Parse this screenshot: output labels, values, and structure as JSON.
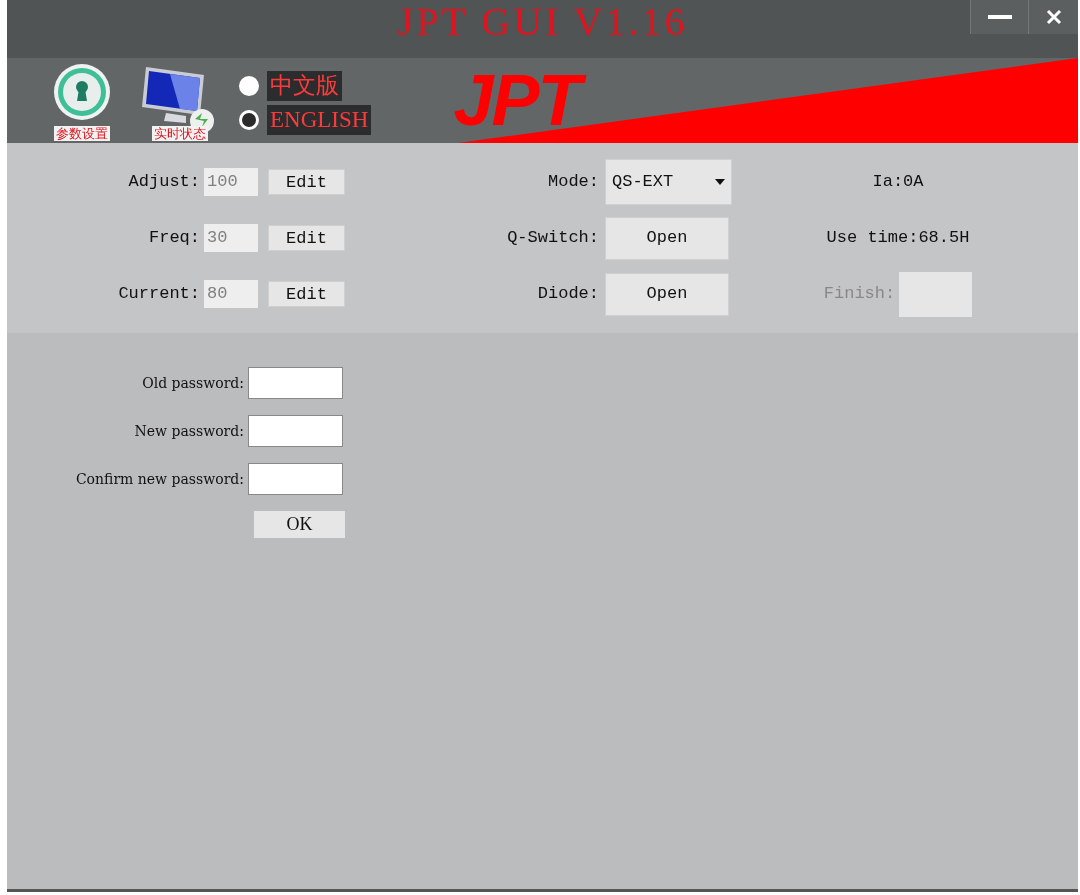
{
  "window": {
    "title": "JPT GUI V1.16"
  },
  "toolbar": {
    "tools": [
      {
        "kind": "lock",
        "label": "参数设置"
      },
      {
        "kind": "monitor",
        "label": "实时状态"
      }
    ],
    "languages": [
      {
        "label": "中文版",
        "selected": false
      },
      {
        "label": "ENGLISH",
        "selected": true
      }
    ],
    "logo": "JPT"
  },
  "parameters": [
    {
      "label": "Adjust:",
      "value": "100",
      "disabled": true,
      "button": "Edit"
    },
    {
      "label": "Freq:",
      "value": "30",
      "disabled": true,
      "button": "Edit"
    },
    {
      "label": "Current:",
      "value": "80",
      "disabled": true,
      "button": "Edit"
    }
  ],
  "controls": [
    {
      "label": "Mode:",
      "kind": "dropdown",
      "value": "QS-EXT"
    },
    {
      "label": "Q-Switch:",
      "kind": "button",
      "value": "Open"
    },
    {
      "label": "Diode:",
      "kind": "button",
      "value": "Open"
    }
  ],
  "status": [
    {
      "kind": "text",
      "text": "Ia:0A"
    },
    {
      "kind": "text",
      "text": "Use time:68.5H"
    },
    {
      "kind": "field",
      "text": "Finish:",
      "disabled": true
    }
  ],
  "password": {
    "fields": [
      {
        "label": "Old password:"
      },
      {
        "label": "New password:"
      },
      {
        "label": "Confirm new password:"
      }
    ],
    "button": "OK"
  }
}
